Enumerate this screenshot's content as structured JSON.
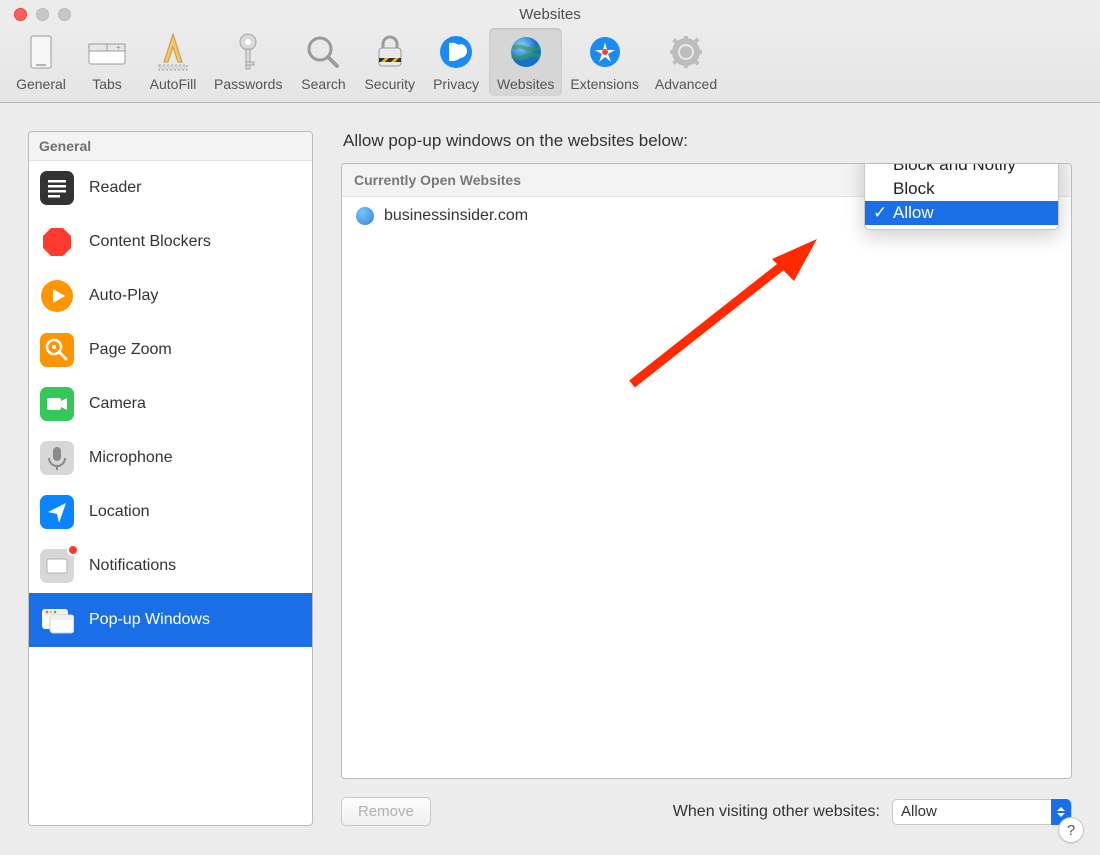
{
  "window": {
    "title": "Websites"
  },
  "toolbar": {
    "items": [
      {
        "label": "General"
      },
      {
        "label": "Tabs"
      },
      {
        "label": "AutoFill"
      },
      {
        "label": "Passwords"
      },
      {
        "label": "Search"
      },
      {
        "label": "Security"
      },
      {
        "label": "Privacy"
      },
      {
        "label": "Websites"
      },
      {
        "label": "Extensions"
      },
      {
        "label": "Advanced"
      }
    ],
    "selected_index": 7
  },
  "sidebar": {
    "heading": "General",
    "items": [
      {
        "label": "Reader"
      },
      {
        "label": "Content Blockers"
      },
      {
        "label": "Auto-Play"
      },
      {
        "label": "Page Zoom"
      },
      {
        "label": "Camera"
      },
      {
        "label": "Microphone"
      },
      {
        "label": "Location"
      },
      {
        "label": "Notifications"
      },
      {
        "label": "Pop-up Windows"
      }
    ],
    "selected_index": 8
  },
  "main": {
    "title": "Allow pop-up windows on the websites below:",
    "subheader": "Currently Open Websites",
    "sites": [
      {
        "domain": "businessinsider.com"
      }
    ],
    "dropdown": {
      "options": [
        "Block and Notify",
        "Block",
        "Allow"
      ],
      "selected_index": 2
    },
    "remove_label": "Remove",
    "other_sites_label": "When visiting other websites:",
    "other_sites_value": "Allow"
  },
  "help_label": "?"
}
